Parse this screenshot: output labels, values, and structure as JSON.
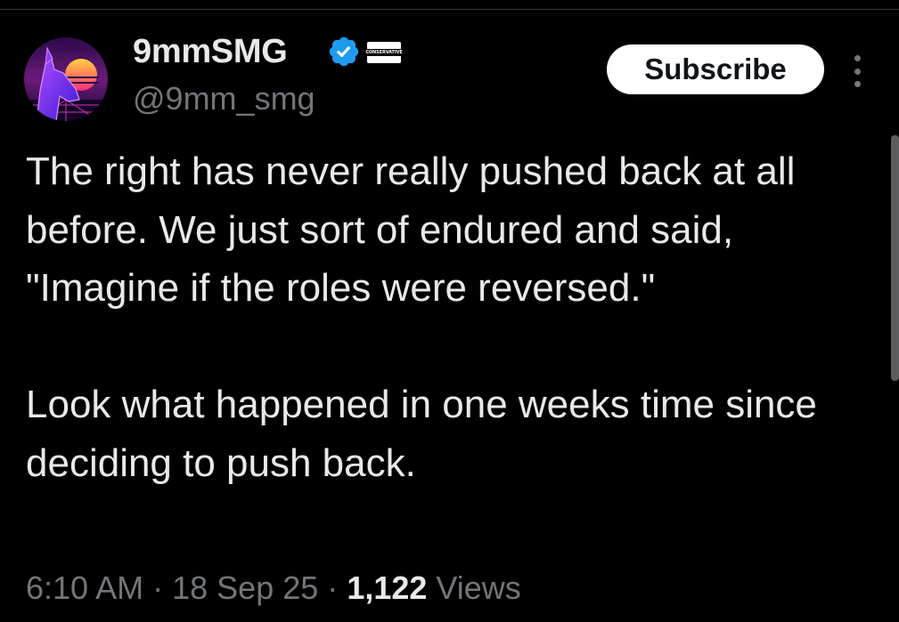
{
  "author": {
    "display_name": "9mmSMG",
    "handle": "@9mm_smg",
    "verified": true,
    "affiliate_badge_text": "CONSERVATIVE"
  },
  "actions": {
    "subscribe_label": "Subscribe",
    "more_icon": "more-vertical-icon"
  },
  "tweet": {
    "paragraph_1": "The right has never really pushed back at all before. We just sort of endured and said, \"Imagine if the roles were reversed.\"",
    "paragraph_2": "Look what happened in one weeks time since deciding to push back."
  },
  "meta": {
    "time": "6:10 AM",
    "separator": "·",
    "date": "18 Sep 25",
    "views_count": "1,122",
    "views_label": "Views"
  },
  "colors": {
    "background": "#000000",
    "text_primary": "#e7e9ea",
    "text_secondary": "#71767b",
    "verified_blue": "#1d9bf0",
    "button_bg": "#ffffff"
  }
}
